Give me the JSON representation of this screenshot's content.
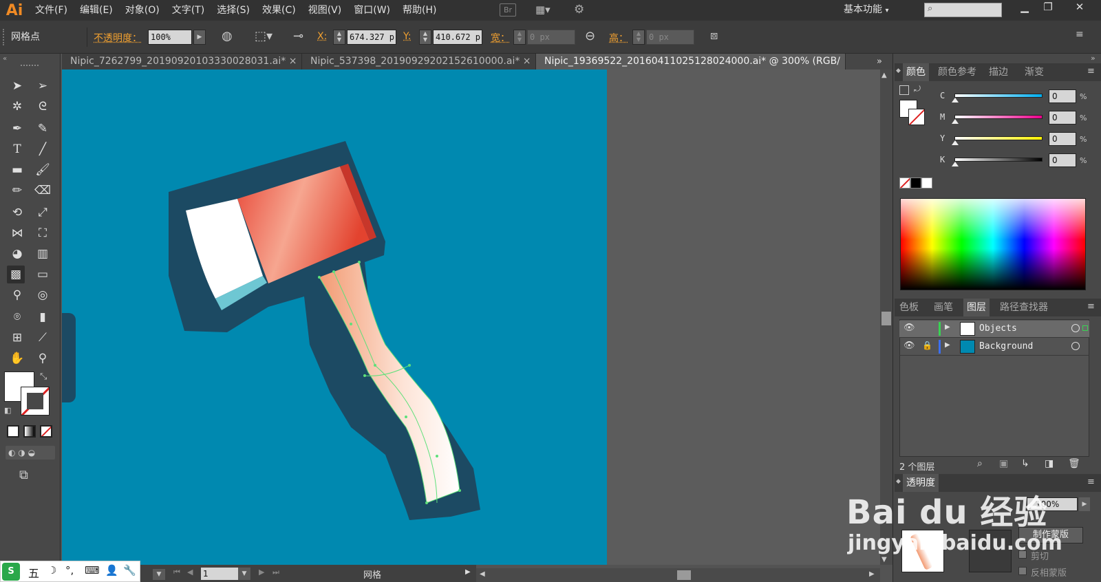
{
  "app": {
    "logo": "Ai"
  },
  "menu": [
    "文件(F)",
    "编辑(E)",
    "对象(O)",
    "文字(T)",
    "选择(S)",
    "效果(C)",
    "视图(V)",
    "窗口(W)",
    "帮助(H)"
  ],
  "topbar": {
    "bridge": "Br",
    "workspace": "基本功能",
    "workspace_arrow": "▾"
  },
  "control": {
    "tool_label": "网格点",
    "opacity_label": "不透明度：",
    "opacity_value": "100%",
    "x_label": "X:",
    "x_value": "674.327 p",
    "y_label": "Y:",
    "y_value": "410.672 p",
    "w_label": "宽：",
    "w_value": "0 px",
    "h_label": "高：",
    "h_value": "0 px"
  },
  "tabs": [
    {
      "label": "Nipic_7262799_20190920103330028031.ai*"
    },
    {
      "label": "Nipic_537398_20190929202152610000.ai*"
    },
    {
      "label": "Nipic_19369522_20160411025128024000.ai* @ 300% (RGB/"
    }
  ],
  "tab_close": "×",
  "status": {
    "zoom_page": "1",
    "tool_name": "网格"
  },
  "color_panel": {
    "tabs": [
      "颜色",
      "颜色参考",
      "描边",
      "渐变"
    ],
    "channels": [
      {
        "name": "C",
        "value": "0",
        "color": "#00aeef"
      },
      {
        "name": "M",
        "value": "0",
        "color": "#ec008c"
      },
      {
        "name": "Y",
        "value": "0",
        "color": "#fff200"
      },
      {
        "name": "K",
        "value": "0",
        "color": "#000000"
      }
    ],
    "unit": "%"
  },
  "layers_panel": {
    "tabs": [
      "色板",
      "画笔",
      "图层",
      "路径查找器"
    ],
    "layers": [
      {
        "name": "Objects",
        "color": "#39d353"
      },
      {
        "name": "Background",
        "color": "#3c6ff0"
      }
    ],
    "count": "2 个图层"
  },
  "transparency_panel": {
    "title": "透明度",
    "opacity_value": "100%",
    "make_mask": "制作蒙版",
    "clip": "剪切",
    "invert": "反相蒙版"
  },
  "ime": {
    "mode": "五"
  },
  "watermark": {
    "logo": "Bai du 经验",
    "url": "jingyan.baidu.com"
  },
  "artwork": {
    "bg": "#0089b0",
    "outline": "#1c4a63",
    "blade": "#ffffff",
    "head": "#e9573f",
    "handle": "#f4a77e"
  }
}
